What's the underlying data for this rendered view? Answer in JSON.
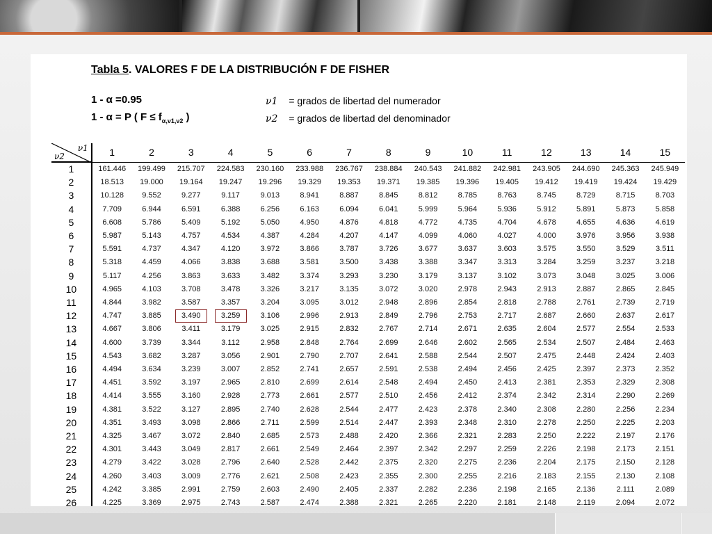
{
  "slide": {
    "accent_color": "#c8683a"
  },
  "document": {
    "title_prefix": "Tabla 5",
    "title_rest": ". VALORES F DE LA DISTRIBUCIÓN F DE FISHER",
    "line1_left": "1 - α =0.95",
    "line2_left": "1 - α = P ( F ≤ f",
    "line2_sub": "α,ν1,ν2",
    "line2_close": " )",
    "nu1_symbol": "ν1",
    "nu1_text": "= grados de libertad del numerador",
    "nu2_symbol": "ν2",
    "nu2_text": "= grados de libertad del denominador",
    "corner_top": "ν1",
    "corner_bottom": "ν2"
  },
  "table": {
    "columns": [
      "1",
      "2",
      "3",
      "4",
      "5",
      "6",
      "7",
      "8",
      "9",
      "10",
      "11",
      "12",
      "13",
      "14",
      "15"
    ],
    "rows": [
      {
        "v2": "1",
        "values": [
          "161.446",
          "199.499",
          "215.707",
          "224.583",
          "230.160",
          "233.988",
          "236.767",
          "238.884",
          "240.543",
          "241.882",
          "242.981",
          "243.905",
          "244.690",
          "245.363",
          "245.949"
        ]
      },
      {
        "v2": "2",
        "values": [
          "18.513",
          "19.000",
          "19.164",
          "19.247",
          "19.296",
          "19.329",
          "19.353",
          "19.371",
          "19.385",
          "19.396",
          "19.405",
          "19.412",
          "19.419",
          "19.424",
          "19.429"
        ]
      },
      {
        "v2": "3",
        "values": [
          "10.128",
          "9.552",
          "9.277",
          "9.117",
          "9.013",
          "8.941",
          "8.887",
          "8.845",
          "8.812",
          "8.785",
          "8.763",
          "8.745",
          "8.729",
          "8.715",
          "8.703"
        ]
      },
      {
        "v2": "4",
        "values": [
          "7.709",
          "6.944",
          "6.591",
          "6.388",
          "6.256",
          "6.163",
          "6.094",
          "6.041",
          "5.999",
          "5.964",
          "5.936",
          "5.912",
          "5.891",
          "5.873",
          "5.858"
        ]
      },
      {
        "v2": "5",
        "values": [
          "6.608",
          "5.786",
          "5.409",
          "5.192",
          "5.050",
          "4.950",
          "4.876",
          "4.818",
          "4.772",
          "4.735",
          "4.704",
          "4.678",
          "4.655",
          "4.636",
          "4.619"
        ]
      },
      {
        "v2": "6",
        "values": [
          "5.987",
          "5.143",
          "4.757",
          "4.534",
          "4.387",
          "4.284",
          "4.207",
          "4.147",
          "4.099",
          "4.060",
          "4.027",
          "4.000",
          "3.976",
          "3.956",
          "3.938"
        ]
      },
      {
        "v2": "7",
        "values": [
          "5.591",
          "4.737",
          "4.347",
          "4.120",
          "3.972",
          "3.866",
          "3.787",
          "3.726",
          "3.677",
          "3.637",
          "3.603",
          "3.575",
          "3.550",
          "3.529",
          "3.511"
        ]
      },
      {
        "v2": "8",
        "values": [
          "5.318",
          "4.459",
          "4.066",
          "3.838",
          "3.688",
          "3.581",
          "3.500",
          "3.438",
          "3.388",
          "3.347",
          "3.313",
          "3.284",
          "3.259",
          "3.237",
          "3.218"
        ]
      },
      {
        "v2": "9",
        "values": [
          "5.117",
          "4.256",
          "3.863",
          "3.633",
          "3.482",
          "3.374",
          "3.293",
          "3.230",
          "3.179",
          "3.137",
          "3.102",
          "3.073",
          "3.048",
          "3.025",
          "3.006"
        ]
      },
      {
        "v2": "10",
        "values": [
          "4.965",
          "4.103",
          "3.708",
          "3.478",
          "3.326",
          "3.217",
          "3.135",
          "3.072",
          "3.020",
          "2.978",
          "2.943",
          "2.913",
          "2.887",
          "2.865",
          "2.845"
        ]
      },
      {
        "v2": "11",
        "values": [
          "4.844",
          "3.982",
          "3.587",
          "3.357",
          "3.204",
          "3.095",
          "3.012",
          "2.948",
          "2.896",
          "2.854",
          "2.818",
          "2.788",
          "2.761",
          "2.739",
          "2.719"
        ]
      },
      {
        "v2": "12",
        "values": [
          "4.747",
          "3.885",
          "3.490",
          "3.259",
          "3.106",
          "2.996",
          "2.913",
          "2.849",
          "2.796",
          "2.753",
          "2.717",
          "2.687",
          "2.660",
          "2.637",
          "2.617"
        ]
      },
      {
        "v2": "13",
        "values": [
          "4.667",
          "3.806",
          "3.411",
          "3.179",
          "3.025",
          "2.915",
          "2.832",
          "2.767",
          "2.714",
          "2.671",
          "2.635",
          "2.604",
          "2.577",
          "2.554",
          "2.533"
        ]
      },
      {
        "v2": "14",
        "values": [
          "4.600",
          "3.739",
          "3.344",
          "3.112",
          "2.958",
          "2.848",
          "2.764",
          "2.699",
          "2.646",
          "2.602",
          "2.565",
          "2.534",
          "2.507",
          "2.484",
          "2.463"
        ]
      },
      {
        "v2": "15",
        "values": [
          "4.543",
          "3.682",
          "3.287",
          "3.056",
          "2.901",
          "2.790",
          "2.707",
          "2.641",
          "2.588",
          "2.544",
          "2.507",
          "2.475",
          "2.448",
          "2.424",
          "2.403"
        ]
      },
      {
        "v2": "16",
        "values": [
          "4.494",
          "3.634",
          "3.239",
          "3.007",
          "2.852",
          "2.741",
          "2.657",
          "2.591",
          "2.538",
          "2.494",
          "2.456",
          "2.425",
          "2.397",
          "2.373",
          "2.352"
        ]
      },
      {
        "v2": "17",
        "values": [
          "4.451",
          "3.592",
          "3.197",
          "2.965",
          "2.810",
          "2.699",
          "2.614",
          "2.548",
          "2.494",
          "2.450",
          "2.413",
          "2.381",
          "2.353",
          "2.329",
          "2.308"
        ]
      },
      {
        "v2": "18",
        "values": [
          "4.414",
          "3.555",
          "3.160",
          "2.928",
          "2.773",
          "2.661",
          "2.577",
          "2.510",
          "2.456",
          "2.412",
          "2.374",
          "2.342",
          "2.314",
          "2.290",
          "2.269"
        ]
      },
      {
        "v2": "19",
        "values": [
          "4.381",
          "3.522",
          "3.127",
          "2.895",
          "2.740",
          "2.628",
          "2.544",
          "2.477",
          "2.423",
          "2.378",
          "2.340",
          "2.308",
          "2.280",
          "2.256",
          "2.234"
        ]
      },
      {
        "v2": "20",
        "values": [
          "4.351",
          "3.493",
          "3.098",
          "2.866",
          "2.711",
          "2.599",
          "2.514",
          "2.447",
          "2.393",
          "2.348",
          "2.310",
          "2.278",
          "2.250",
          "2.225",
          "2.203"
        ]
      },
      {
        "v2": "21",
        "values": [
          "4.325",
          "3.467",
          "3.072",
          "2.840",
          "2.685",
          "2.573",
          "2.488",
          "2.420",
          "2.366",
          "2.321",
          "2.283",
          "2.250",
          "2.222",
          "2.197",
          "2.176"
        ]
      },
      {
        "v2": "22",
        "values": [
          "4.301",
          "3.443",
          "3.049",
          "2.817",
          "2.661",
          "2.549",
          "2.464",
          "2.397",
          "2.342",
          "2.297",
          "2.259",
          "2.226",
          "2.198",
          "2.173",
          "2.151"
        ]
      },
      {
        "v2": "23",
        "values": [
          "4.279",
          "3.422",
          "3.028",
          "2.796",
          "2.640",
          "2.528",
          "2.442",
          "2.375",
          "2.320",
          "2.275",
          "2.236",
          "2.204",
          "2.175",
          "2.150",
          "2.128"
        ]
      },
      {
        "v2": "24",
        "values": [
          "4.260",
          "3.403",
          "3.009",
          "2.776",
          "2.621",
          "2.508",
          "2.423",
          "2.355",
          "2.300",
          "2.255",
          "2.216",
          "2.183",
          "2.155",
          "2.130",
          "2.108"
        ]
      },
      {
        "v2": "25",
        "values": [
          "4.242",
          "3.385",
          "2.991",
          "2.759",
          "2.603",
          "2.490",
          "2.405",
          "2.337",
          "2.282",
          "2.236",
          "2.198",
          "2.165",
          "2.136",
          "2.111",
          "2.089"
        ]
      },
      {
        "v2": "26",
        "values": [
          "4.225",
          "3.369",
          "2.975",
          "2.743",
          "2.587",
          "2.474",
          "2.388",
          "2.321",
          "2.265",
          "2.220",
          "2.181",
          "2.148",
          "2.119",
          "2.094",
          "2.072"
        ]
      }
    ],
    "highlighted_cells": [
      {
        "row": "12",
        "col": "3"
      },
      {
        "row": "12",
        "col": "4"
      }
    ],
    "highlight_color": "#8b2a2a"
  }
}
